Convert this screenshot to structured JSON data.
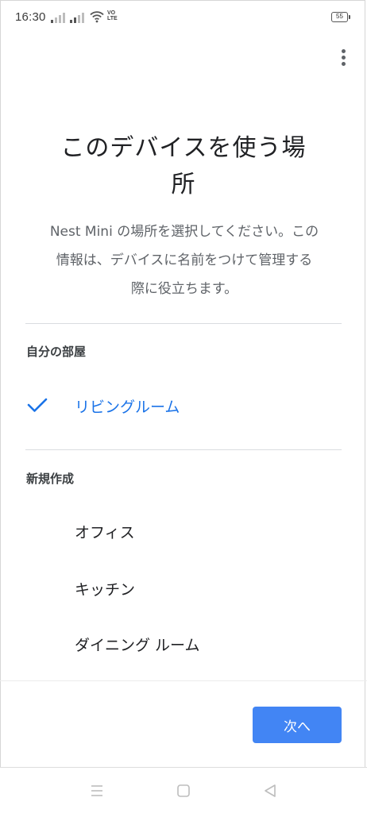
{
  "status_bar": {
    "time": "16:30",
    "network_label_top": "VO",
    "network_label_bottom": "LTE",
    "battery_level": "55"
  },
  "header": {
    "menu_icon": "more-vert-icon"
  },
  "page": {
    "title_line1": "このデバイスを使う場",
    "title_line2": "所",
    "description_line1": "Nest Mini の場所を選択してください。この",
    "description_line2": "情報は、デバイスに名前をつけて管理する",
    "description_line3": "際に役立ちます。"
  },
  "sections": {
    "my_rooms": {
      "header": "自分の部屋",
      "items": [
        {
          "label": "リビングルーム",
          "selected": true
        }
      ]
    },
    "create_new": {
      "header": "新規作成",
      "items": [
        {
          "label": "オフィス"
        },
        {
          "label": "キッチン"
        },
        {
          "label": "ダイニング ルーム"
        }
      ]
    }
  },
  "footer": {
    "next_label": "次へ",
    "accent_color": "#4285f4",
    "selected_color": "#1a73e8"
  },
  "nav": {
    "menu_icon": "menu-icon",
    "home_icon": "home-square-icon",
    "back_icon": "back-triangle-icon"
  }
}
